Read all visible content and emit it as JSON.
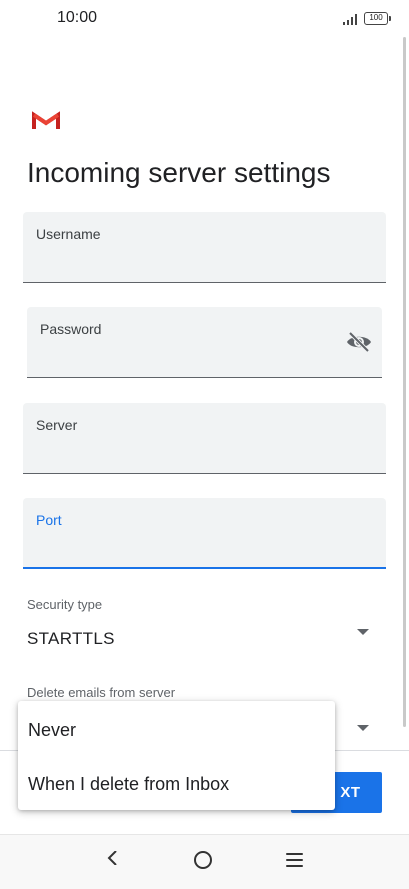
{
  "status_bar": {
    "time": "10:00",
    "battery": "100"
  },
  "header": {
    "title": "Incoming server settings"
  },
  "fields": {
    "username": {
      "label": "Username",
      "value": ""
    },
    "password": {
      "label": "Password",
      "value": ""
    },
    "server": {
      "label": "Server",
      "value": ""
    },
    "port": {
      "label": "Port",
      "value": ""
    }
  },
  "security_type": {
    "label": "Security type",
    "value": "STARTTLS"
  },
  "delete_emails": {
    "label": "Delete emails from server"
  },
  "menu": {
    "items": [
      "Never",
      "When I delete from Inbox"
    ]
  },
  "next_button": {
    "label": "XT"
  },
  "colors": {
    "accent": "#1a73e8",
    "gmail_red": "#ea4335"
  },
  "icons": [
    "gmail-logo",
    "visibility-off-icon",
    "dropdown-arrow-icon",
    "back-icon",
    "home-icon",
    "recents-icon"
  ]
}
